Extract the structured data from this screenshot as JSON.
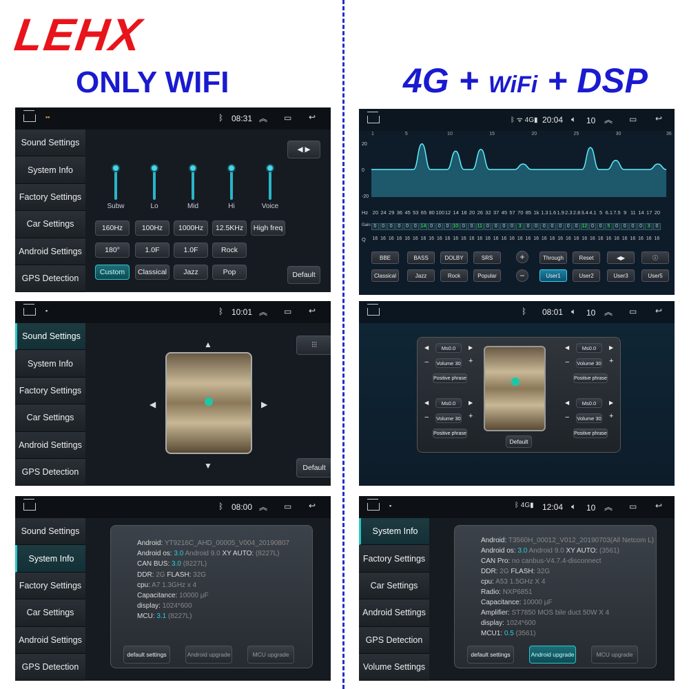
{
  "header": {
    "brand": "LEHX",
    "left_tag": "ONLY WIFI",
    "right_tag_parts": [
      "4G",
      "+",
      "WiFi",
      "+",
      "DSP"
    ]
  },
  "screens": {
    "s1": {
      "time": "08:31",
      "sidebar": [
        "Sound Settings",
        "System Info",
        "Factory Settings",
        "Car Settings",
        "Android Settings",
        "GPS Detection"
      ],
      "sliders": [
        {
          "label": "Subw",
          "level": 0.05
        },
        {
          "label": "Lo",
          "level": 0.05
        },
        {
          "label": "Mid",
          "level": 0.05
        },
        {
          "label": "Hi",
          "level": 0.05
        },
        {
          "label": "Voice",
          "level": 0.05
        }
      ],
      "row1": [
        "160Hz",
        "100Hz",
        "1000Hz",
        "12.5KHz",
        "High freq"
      ],
      "row2": [
        "180°",
        "1.0F",
        "1.0F",
        "Rock"
      ],
      "row3": [
        "Custom",
        "Classical",
        "Jazz",
        "Pop"
      ],
      "default_label": "Default"
    },
    "s2": {
      "time": "10:01",
      "sidebar": [
        "Sound Settings",
        "System Info",
        "Factory Settings",
        "Car Settings",
        "Android Settings",
        "GPS Detection"
      ],
      "default_label": "Default"
    },
    "s3": {
      "time": "08:00",
      "sidebar": [
        "Sound Settings",
        "System Info",
        "Factory Settings",
        "Car Settings",
        "Android Settings",
        "GPS Detection"
      ],
      "info": [
        {
          "k": "Android:",
          "v": "YT9216C_AHD_00005_V004_20190807"
        },
        {
          "k": "Android os:",
          "v": "Android 9.0",
          "k2": "XY AUTO:",
          "h": "3.0",
          "v2": "(8227L)"
        },
        {
          "k": "CAN BUS:",
          "h": "3.0",
          "v": "(8227L)"
        },
        {
          "k": "DDR:",
          "v": "2G",
          "k2": "FLASH:",
          "v2": "32G"
        },
        {
          "k": "cpu:",
          "v": "A7 1.3GHz x 4"
        },
        {
          "k": "Capacitance:",
          "v": "10000 μF"
        },
        {
          "k": "display:",
          "v": "1024*600"
        },
        {
          "k": "MCU:",
          "h": "3.1",
          "v": "(8227L)"
        }
      ],
      "buttons": [
        "default settings",
        "Android upgrade",
        "MCU upgrade"
      ]
    },
    "s4": {
      "time": "20:04",
      "volume": "10",
      "top_scale": [
        "1",
        "5",
        "10",
        "15",
        "20",
        "25",
        "30",
        "36"
      ],
      "y_ticks": [
        "20",
        "0",
        "-20"
      ],
      "hz_label": "Hz",
      "freqs": [
        "20",
        "24",
        "29",
        "36",
        "45",
        "53",
        "65",
        "80",
        "100",
        "12",
        "14",
        "18",
        "20",
        "26",
        "32",
        "37",
        "45",
        "57",
        "70",
        "85",
        "1k",
        "1.3",
        "1.6",
        "1.9",
        "2.3",
        "2.8",
        "3.4",
        "4.1",
        "5",
        "6.1",
        "7.5",
        "9",
        "11",
        "14",
        "17",
        "20"
      ],
      "gain_label": "Gain",
      "gains": [
        0,
        0,
        0,
        0,
        0,
        0,
        14,
        0,
        0,
        0,
        10,
        0,
        0,
        11,
        0,
        0,
        0,
        0,
        3,
        0,
        0,
        0,
        0,
        0,
        0,
        0,
        12,
        0,
        0,
        5,
        0,
        0,
        0,
        0,
        3,
        0,
        0
      ],
      "q_label": "Q",
      "q_value": "16",
      "effects": [
        "BBE",
        "BASS",
        "DOLBY",
        "SRS"
      ],
      "actions": [
        "Through",
        "Reset"
      ],
      "presets": [
        "Classical",
        "Jazz",
        "Rock",
        "Popular"
      ],
      "users": [
        "User1",
        "User2",
        "User3",
        "User5"
      ]
    },
    "s5": {
      "time": "08:01",
      "volume": "10",
      "zones": [
        {
          "ms": "Ms0.0",
          "volume": "Volume 30",
          "phase": "Positive phrase"
        },
        {
          "ms": "Ms0.0",
          "volume": "Volume 30",
          "phase": "Positive phrase"
        },
        {
          "ms": "Ms0.0",
          "volume": "Volume 30",
          "phase": "Positive phrase"
        },
        {
          "ms": "Ms0.0",
          "volume": "Volume 30",
          "phase": "Positive phrase"
        }
      ],
      "default_label": "Default"
    },
    "s6": {
      "time": "12:04",
      "volume": "10",
      "sidebar": [
        "System Info",
        "Factory Settings",
        "Car Settings",
        "Android Settings",
        "GPS Detection",
        "Volume Settings"
      ],
      "info": [
        {
          "k": "Android:",
          "v": "T3560H_00012_V012_20190703(All Netcom L)"
        },
        {
          "k": "Android os:",
          "v": "Android 9.0",
          "k2": "XY AUTO:",
          "h": "3.0",
          "v2": "(3561)"
        },
        {
          "k": "CAN Pro:",
          "v": "no canbus-V4.7.4-disconnect"
        },
        {
          "k": "DDR:",
          "v": "2G",
          "k2": "FLASH:",
          "v2": "32G"
        },
        {
          "k": "cpu:",
          "v": "A53 1.5GHz X 4"
        },
        {
          "k": "Radio:",
          "v": "NXP6851"
        },
        {
          "k": "Capacitance:",
          "v": "10000 μF"
        },
        {
          "k": "Amplifier:",
          "v": "ST7850 MOS bile duct 50W X 4"
        },
        {
          "k": "display:",
          "v": "1024*600"
        },
        {
          "k": "MCU1:",
          "h": "0.5",
          "v": "(3561)"
        }
      ],
      "buttons": [
        "default settings",
        "Android upgrade",
        "MCU upgrade"
      ]
    }
  },
  "colors": {
    "brand_red": "#e8141c",
    "tag_blue": "#1a1ad0",
    "accent_cyan": "#2ac5d0"
  }
}
